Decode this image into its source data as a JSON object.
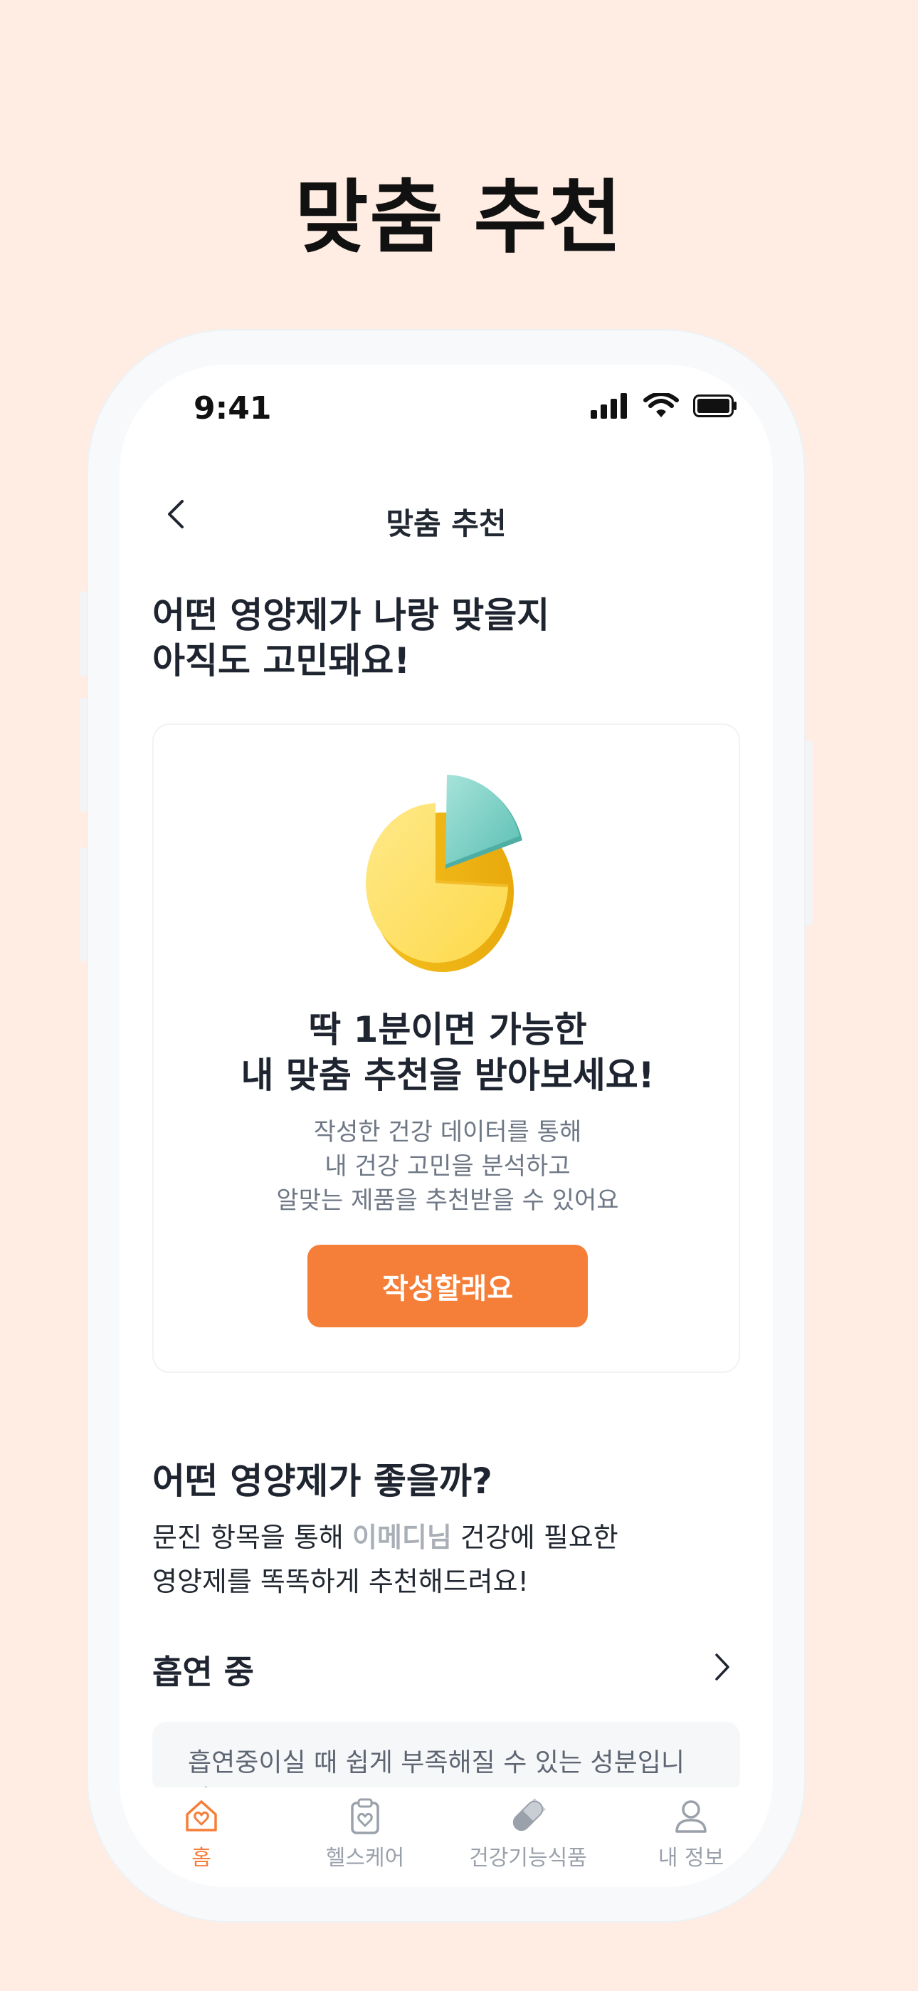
{
  "hero": {
    "title": "맞춤 추천"
  },
  "status_bar": {
    "time": "9:41",
    "icons": [
      "signal-icon",
      "wifi-icon",
      "battery-icon"
    ]
  },
  "nav": {
    "title": "맞춤 추천",
    "back_icon": "chevron-left-icon"
  },
  "intro": {
    "line1": "어떤 영양제가 나랑 맞을지",
    "line2": "아직도 고민돼요!"
  },
  "card": {
    "illustration": "pie-chart-illustration",
    "title_line1": "딱 1분이면 가능한",
    "title_line2": "내 맞춤 추천을 받아보세요!",
    "desc_line1": "작성한 건강 데이터를 통해",
    "desc_line2": "내 건강 고민을 분석하고",
    "desc_line3": "알맞는 제품을 추천받을 수 있어요",
    "button_label": "작성할래요"
  },
  "section": {
    "heading": "어떤 영양제가 좋을까?",
    "desc_prefix": "문진 항목을 통해 ",
    "desc_name": "이메디님",
    "desc_suffix": " 건강에 필요한",
    "desc_line2": "영양제를 똑똑하게 추천해드려요!"
  },
  "topic": {
    "label": "흡연 중",
    "chevron_icon": "chevron-right-icon"
  },
  "info": {
    "text": "흡연중이실 때 쉽게 부족해질 수 있는 성분입니다."
  },
  "tabs": [
    {
      "label": "홈",
      "icon": "home-heart-icon",
      "active": true
    },
    {
      "label": "헬스케어",
      "icon": "clipboard-heart-icon",
      "active": false
    },
    {
      "label": "건강기능식품",
      "icon": "pill-icon",
      "active": false
    },
    {
      "label": "내 정보",
      "icon": "user-icon",
      "active": false
    }
  ],
  "colors": {
    "background": "#FFEDE3",
    "accent": "#F57E38",
    "text_primary": "#1F2530",
    "text_secondary": "#6E7785",
    "tab_inactive": "#9AA1AB",
    "pie_yellow": "#FFE066",
    "pie_teal": "#6CCBC0"
  }
}
